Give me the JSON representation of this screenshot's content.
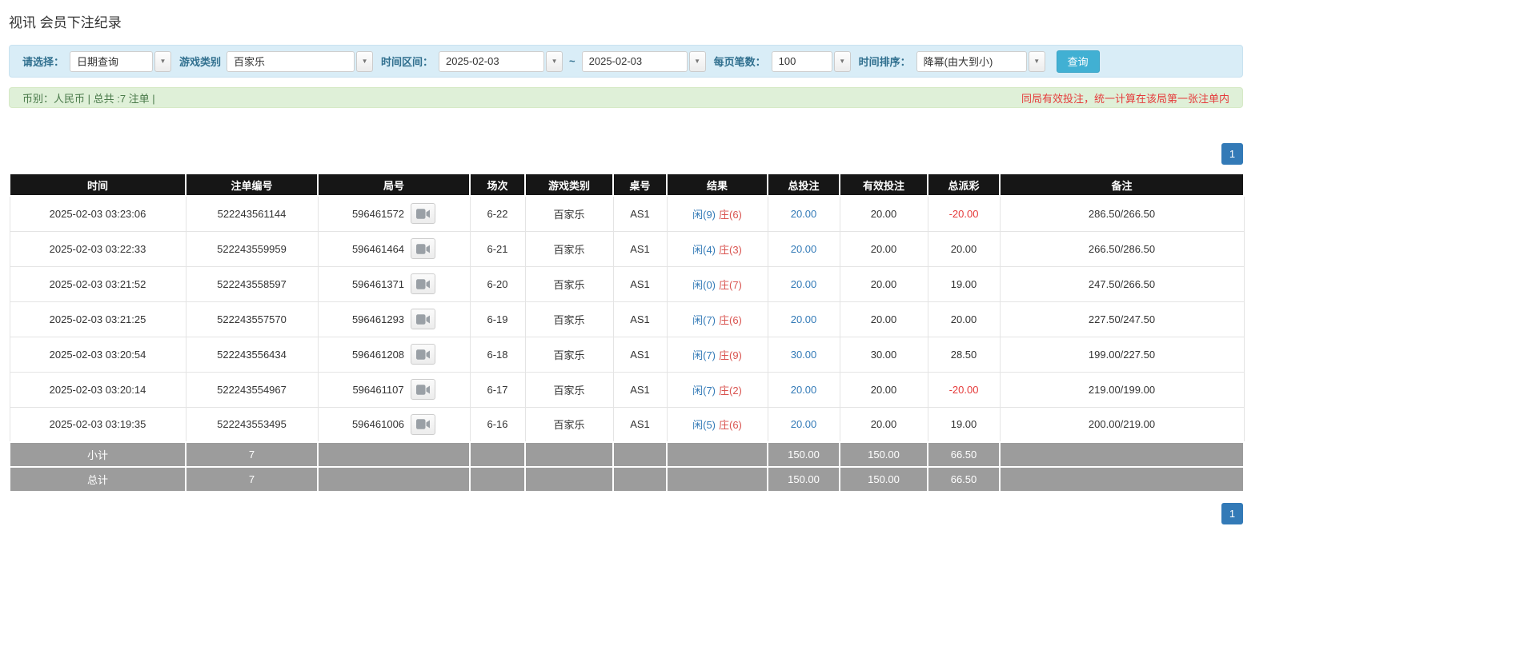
{
  "page": {
    "title": "视讯 会员下注纪录"
  },
  "icons": {
    "dropdown_arrow": "▼"
  },
  "filters": {
    "select_label": "请选择：",
    "select_value": "日期查询",
    "game_type_label": "游戏类别",
    "game_type_value": "百家乐",
    "date_range_label": "时间区间：",
    "date_from": "2025-02-03",
    "date_separator": "~",
    "date_to": "2025-02-03",
    "page_size_label": "每页笔数：",
    "page_size_value": "100",
    "sort_label": "时间排序：",
    "sort_value": "降幂(由大到小)",
    "search_button": "查询"
  },
  "info_bar": {
    "left": "币别：人民币 | 总共 :7 注单 |",
    "right": "同局有效投注，统一计算在该局第一张注单内"
  },
  "pagination": {
    "page": "1"
  },
  "table": {
    "headers": [
      "时间",
      "注单编号",
      "局号",
      "场次",
      "游戏类别",
      "桌号",
      "结果",
      "总投注",
      "有效投注",
      "总派彩",
      "备注"
    ],
    "rows": [
      {
        "time": "2025-02-03 03:23:06",
        "bet_id": "522243561144",
        "round_id": "596461572",
        "session": "6-22",
        "game": "百家乐",
        "table_no": "AS1",
        "result_player": "闲(9)",
        "result_banker": "庄(6)",
        "total_bet": "20.00",
        "valid_bet": "20.00",
        "payout": "-20.00",
        "remark": "286.50/266.50"
      },
      {
        "time": "2025-02-03 03:22:33",
        "bet_id": "522243559959",
        "round_id": "596461464",
        "session": "6-21",
        "game": "百家乐",
        "table_no": "AS1",
        "result_player": "闲(4)",
        "result_banker": "庄(3)",
        "total_bet": "20.00",
        "valid_bet": "20.00",
        "payout": "20.00",
        "remark": "266.50/286.50"
      },
      {
        "time": "2025-02-03 03:21:52",
        "bet_id": "522243558597",
        "round_id": "596461371",
        "session": "6-20",
        "game": "百家乐",
        "table_no": "AS1",
        "result_player": "闲(0)",
        "result_banker": "庄(7)",
        "total_bet": "20.00",
        "valid_bet": "20.00",
        "payout": "19.00",
        "remark": "247.50/266.50"
      },
      {
        "time": "2025-02-03 03:21:25",
        "bet_id": "522243557570",
        "round_id": "596461293",
        "session": "6-19",
        "game": "百家乐",
        "table_no": "AS1",
        "result_player": "闲(7)",
        "result_banker": "庄(6)",
        "total_bet": "20.00",
        "valid_bet": "20.00",
        "payout": "20.00",
        "remark": "227.50/247.50"
      },
      {
        "time": "2025-02-03 03:20:54",
        "bet_id": "522243556434",
        "round_id": "596461208",
        "session": "6-18",
        "game": "百家乐",
        "table_no": "AS1",
        "result_player": "闲(7)",
        "result_banker": "庄(9)",
        "total_bet": "30.00",
        "valid_bet": "30.00",
        "payout": "28.50",
        "remark": "199.00/227.50"
      },
      {
        "time": "2025-02-03 03:20:14",
        "bet_id": "522243554967",
        "round_id": "596461107",
        "session": "6-17",
        "game": "百家乐",
        "table_no": "AS1",
        "result_player": "闲(7)",
        "result_banker": "庄(2)",
        "total_bet": "20.00",
        "valid_bet": "20.00",
        "payout": "-20.00",
        "remark": "219.00/199.00"
      },
      {
        "time": "2025-02-03 03:19:35",
        "bet_id": "522243553495",
        "round_id": "596461006",
        "session": "6-16",
        "game": "百家乐",
        "table_no": "AS1",
        "result_player": "闲(5)",
        "result_banker": "庄(6)",
        "total_bet": "20.00",
        "valid_bet": "20.00",
        "payout": "19.00",
        "remark": "200.00/219.00"
      }
    ],
    "subtotal": {
      "label": "小计",
      "count": "7",
      "total_bet": "150.00",
      "valid_bet": "150.00",
      "payout": "66.50"
    },
    "total": {
      "label": "总计",
      "count": "7",
      "total_bet": "150.00",
      "valid_bet": "150.00",
      "payout": "66.50"
    }
  }
}
